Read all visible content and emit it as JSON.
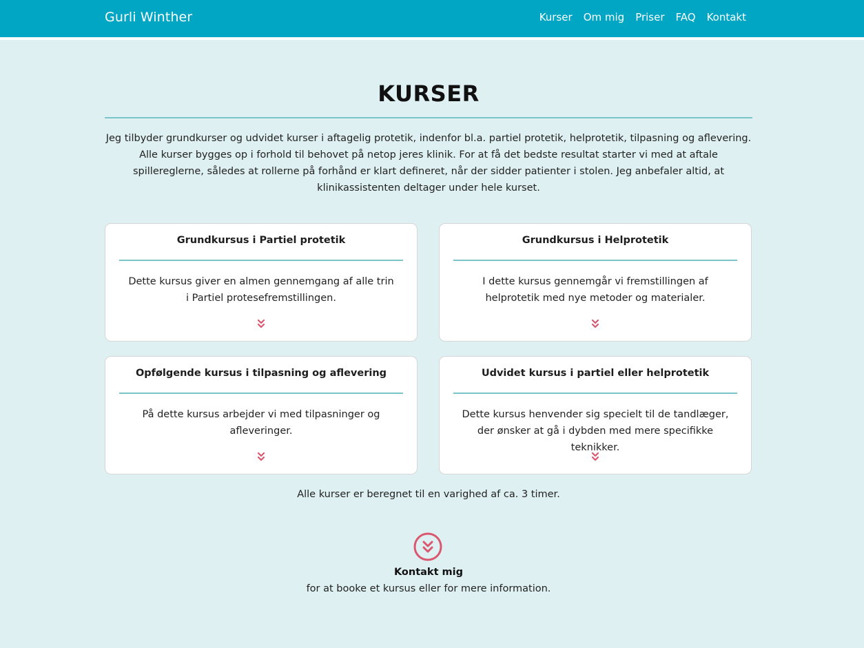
{
  "navbar": {
    "brand": "Gurli Winther",
    "links": [
      "Kurser",
      "Om mig",
      "Priser",
      "FAQ",
      "Kontakt"
    ]
  },
  "main": {
    "title": "KURSER",
    "intro": "Jeg tilbyder grundkurser og udvidet kurser i aftagelig protetik, indenfor bl.a. partiel protetik, helprotetik, tilpasning og aflevering. Alle kurser bygges op i forhold til behovet på netop jeres klinik. For at få det bedste resultat starter vi med at aftale spillereglerne, således at rollerne på forhånd er klart defineret, når der sidder patienter i stolen. Jeg anbefaler altid, at klinikassistenten deltager under hele kurset.",
    "courses": [
      {
        "title": "Grundkursus i Partiel protetik",
        "text": "Dette kursus giver en almen gennemgang af alle trin i Partiel protesefremstillingen."
      },
      {
        "title": "Grundkursus i Helprotetik",
        "text": "I dette kursus gennemgår vi fremstillingen af helprotetik med nye metoder og materialer."
      },
      {
        "title": "Opfølgende kursus i tilpasning og aflevering",
        "text": "På dette kursus arbejder vi med tilpasninger og afleveringer."
      },
      {
        "title": "Udvidet kursus i partiel eller helprotetik",
        "text": "Dette kursus henvender sig specielt til de tandlæger, der ønsker at gå i dybden med mere specifikke teknikker."
      }
    ],
    "footnote": "Alle kurser er beregnet til en varighed af ca. 3 timer.",
    "contact": {
      "title": "Kontakt mig",
      "subtitle": "for at booke et kursus eller for mere information."
    }
  },
  "colors": {
    "navbar_bg": "#00a6c4",
    "section_bg": "#dff0f2",
    "rule": "#79c4c7",
    "accent_chevron": "#d9576f"
  },
  "icons": {
    "card_expand": "double-chevron-down-icon",
    "contact": "circle-double-chevron-down-icon"
  }
}
